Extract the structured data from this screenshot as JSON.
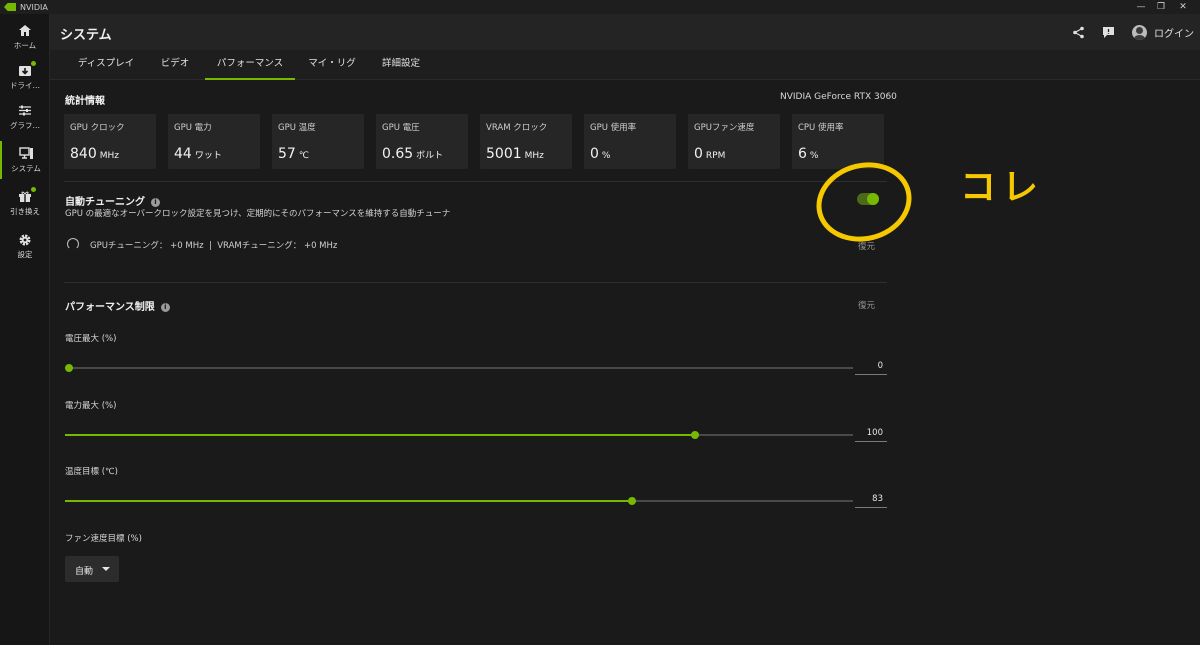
{
  "window": {
    "app_name": "NVIDIA",
    "controls": [
      "—",
      "❐",
      "✕"
    ]
  },
  "sidebar": {
    "items": [
      {
        "label": "ホーム",
        "icon": "home-icon",
        "active": false,
        "dot": false
      },
      {
        "label": "ドライ…",
        "icon": "download-icon",
        "active": false,
        "dot": true
      },
      {
        "label": "グラフ…",
        "icon": "sliders-icon",
        "active": false,
        "dot": false
      },
      {
        "label": "システム",
        "icon": "monitor-icon",
        "active": true,
        "dot": false
      },
      {
        "label": "引き換え",
        "icon": "gift-icon",
        "active": false,
        "dot": true
      },
      {
        "label": "設定",
        "icon": "gear-icon",
        "active": false,
        "dot": false
      }
    ]
  },
  "header": {
    "title": "システム",
    "login_label": "ログイン",
    "icons": [
      "share-icon",
      "feedback-icon"
    ]
  },
  "tabs": [
    {
      "label": "ディスプレイ",
      "active": false
    },
    {
      "label": "ビデオ",
      "active": false
    },
    {
      "label": "パフォーマンス",
      "active": true
    },
    {
      "label": "マイ・リグ",
      "active": false
    },
    {
      "label": "詳細設定",
      "active": false
    }
  ],
  "stats": {
    "title": "統計情報",
    "gpu_name": "NVIDIA GeForce RTX 3060",
    "items": [
      {
        "label": "GPU クロック",
        "value": "840",
        "unit": "MHz"
      },
      {
        "label": "GPU 電力",
        "value": "44",
        "unit": "ワット"
      },
      {
        "label": "GPU 温度",
        "value": "57",
        "unit": "℃"
      },
      {
        "label": "GPU 電圧",
        "value": "0.65",
        "unit": "ボルト"
      },
      {
        "label": "VRAM クロック",
        "value": "5001",
        "unit": "MHz"
      },
      {
        "label": "GPU 使用率",
        "value": "0",
        "unit": "%"
      },
      {
        "label": "GPUファン速度",
        "value": "0",
        "unit": "RPM"
      },
      {
        "label": "CPU 使用率",
        "value": "6",
        "unit": "%"
      }
    ]
  },
  "autotune": {
    "title": "自動チューニング",
    "description": "GPU の最適なオーバークロック設定を見つけ、定期的にそのパフォーマンスを維持する自動チューナ",
    "status": "GPUチューニング： +0 MHz  |  VRAMチューニング： +0 MHz",
    "restore_label": "復元",
    "enabled": true
  },
  "limits": {
    "title": "パフォーマンス制限",
    "restore_label": "復元",
    "sliders": [
      {
        "label": "電圧最大 (%)",
        "value": "0",
        "fraction": 0.0
      },
      {
        "label": "電力最大 (%)",
        "value": "100",
        "fraction": 0.8
      },
      {
        "label": "温度目標 (℃)",
        "value": "83",
        "fraction": 0.719
      }
    ],
    "fan": {
      "label": "ファン速度目標 (%)",
      "selected": "自動"
    }
  },
  "annotation": {
    "text": "コレ",
    "color": "#f5c800"
  },
  "colors": {
    "accent": "#76b900",
    "background": "#1a1a1a",
    "card": "#262626"
  }
}
